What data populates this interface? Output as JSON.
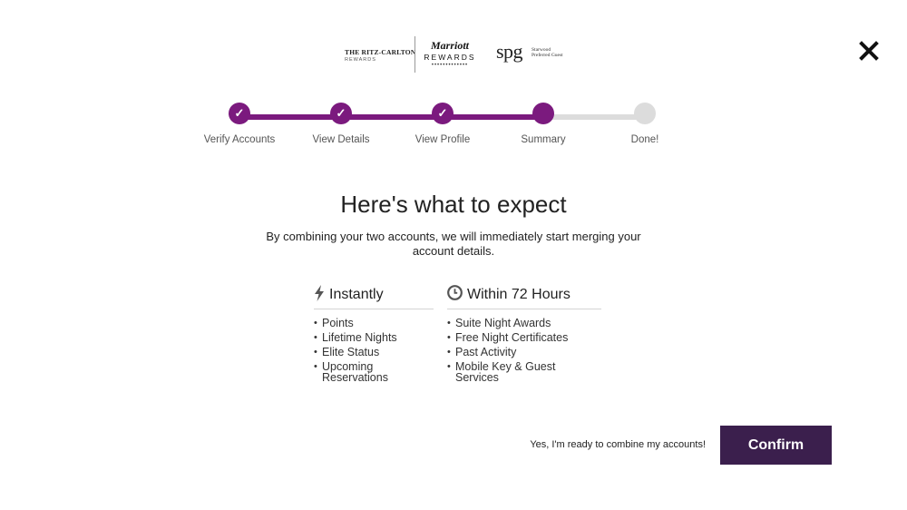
{
  "logos": {
    "ritz_top": "THE RITZ-CARLTON",
    "ritz_bottom": "REWARDS",
    "marriott_script": "Marriott",
    "marriott_rewards": "REWARDS",
    "marriott_dots": "•••••••••••••",
    "spg_word": "spg",
    "spg_sub": "Starwood Preferred Guest"
  },
  "close": {
    "icon": "close-icon"
  },
  "stepper": {
    "steps": [
      {
        "label": "Verify Accounts",
        "state": "done"
      },
      {
        "label": "View Details",
        "state": "done"
      },
      {
        "label": "View Profile",
        "state": "done"
      },
      {
        "label": "Summary",
        "state": "current"
      },
      {
        "label": "Done!",
        "state": "pending"
      }
    ],
    "check_glyph": "✓"
  },
  "main": {
    "heading": "Here's what to expect",
    "subtext": "By combining your two accounts, we will immediately start merging your account details."
  },
  "columns": {
    "instantly": {
      "title": "Instantly",
      "icon": "lightning-icon",
      "items": [
        "Points",
        "Lifetime Nights",
        "Elite Status",
        "Upcoming Reservations"
      ]
    },
    "within72": {
      "title": "Within 72 Hours",
      "icon": "clock-icon",
      "items": [
        "Suite Night Awards",
        "Free Night Certificates",
        "Past Activity",
        "Mobile Key & Guest Services"
      ]
    }
  },
  "footer": {
    "ready_text": "Yes, I'm ready to combine my accounts!",
    "confirm_label": "Confirm"
  },
  "colors": {
    "progress": "#7b1a7e",
    "progress_pending": "#dcdcdc",
    "confirm_bg": "#3b1f4d"
  }
}
